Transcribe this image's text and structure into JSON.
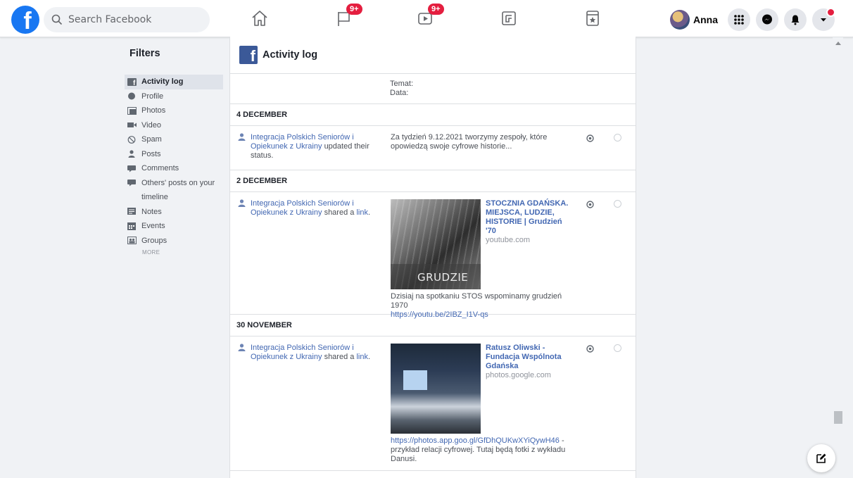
{
  "topbar": {
    "logo": "f",
    "search_placeholder": "Search Facebook",
    "badges": {
      "pages": "9+",
      "watch": "9+"
    },
    "user_name": "Anna"
  },
  "sidebar": {
    "title": "Filters",
    "items": [
      {
        "label": "Activity log",
        "icon": "facebook-square-icon"
      },
      {
        "label": "Profile",
        "icon": "globe-icon"
      },
      {
        "label": "Photos",
        "icon": "photos-icon"
      },
      {
        "label": "Video",
        "icon": "video-icon"
      },
      {
        "label": "Spam",
        "icon": "spam-icon"
      },
      {
        "label": "Posts",
        "icon": "person-icon"
      },
      {
        "label": "Comments",
        "icon": "comment-icon"
      },
      {
        "label": "Others' posts on your",
        "icon": "comment-icon"
      },
      {
        "label": "timeline",
        "icon": ""
      },
      {
        "label": "Notes",
        "icon": "notes-icon"
      },
      {
        "label": "Events",
        "icon": "events-icon"
      },
      {
        "label": "Groups",
        "icon": "groups-icon"
      }
    ],
    "more": "MORE"
  },
  "panel": {
    "title": "Activity log",
    "cut_entry": {
      "line1": "Temat:",
      "line2": "Data:"
    },
    "sections": [
      {
        "date": "4 DECEMBER",
        "actor": "Integracja Polskich Seniorów i Opiekunek z Ukrainy",
        "action": "updated their status.",
        "story": "Za tydzień 9.12.2021 tworzymy zespoły, które opowiedzą swoje cyfrowe historie..."
      },
      {
        "date": "2 DECEMBER",
        "actor": "Integracja Polskich Seniorów i Opiekunek z Ukrainy",
        "action": "shared a",
        "action_link": "link",
        "thumb_text": "GRUDZIE",
        "link_title": "STOCZNIA GDAŃSKA. MIEJSCA, LUDZIE, HISTORIE | Grudzień '70",
        "link_source": "youtube.com",
        "caption": "Dzisiaj na spotkaniu STOS wspominamy grudzień 1970",
        "caption_link": "https://youtu.be/2IBZ_I1V-qs"
      },
      {
        "date": "30 NOVEMBER",
        "actor": "Integracja Polskich Seniorów i Opiekunek z Ukrainy",
        "action": "shared a",
        "action_link": "link",
        "link_title": "Ratusz Oliwski - Fundacja Wspólnota Gdańska",
        "link_source": "photos.google.com",
        "caption_link": "https://photos.app.goo.gl/GfDhQUKwXYiQywH46",
        "caption": "- przykład relacji cyfrowej. Tutaj będą fotki z wykładu Danusi."
      }
    ]
  },
  "colors": {
    "brand": "#1877f2",
    "badge": "#e41e3f",
    "link": "#4267b2"
  }
}
